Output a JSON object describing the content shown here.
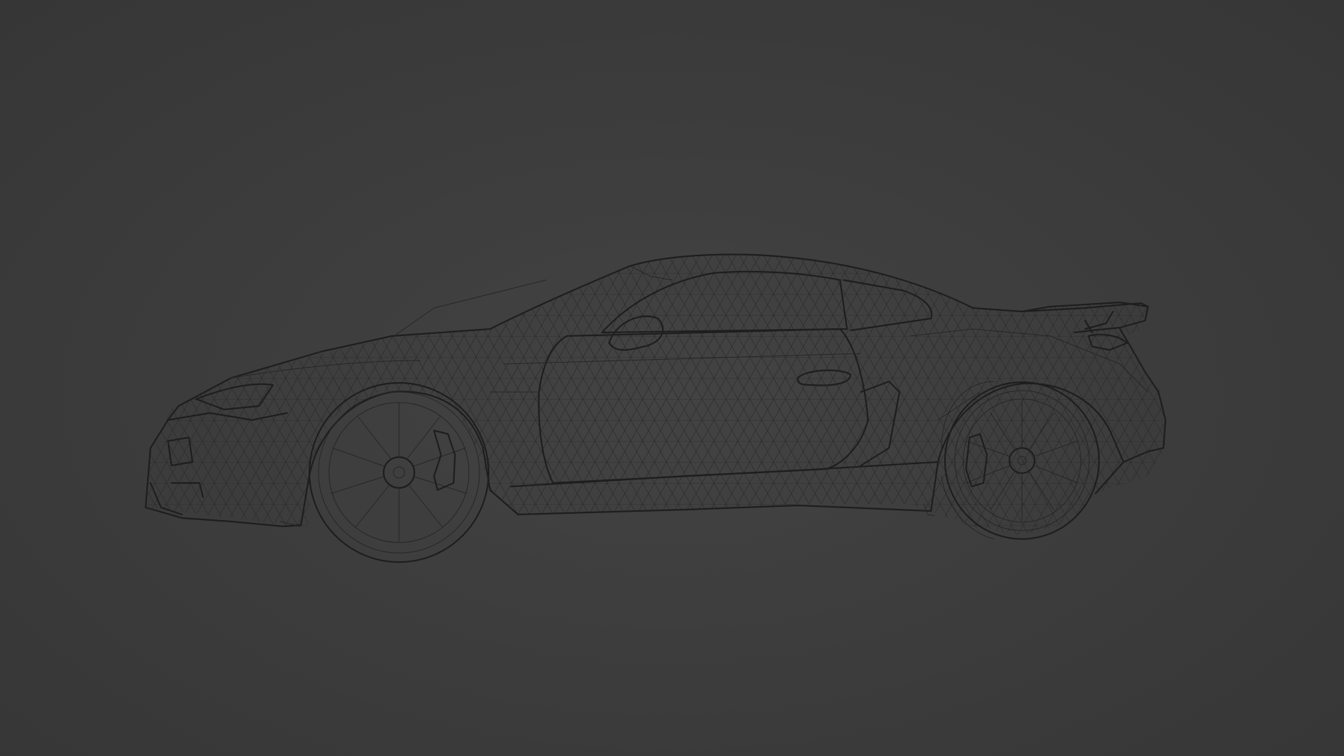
{
  "viewport": {
    "background_color": "#3c3c3c",
    "wire_color": "#1e1e1e",
    "display_mode": "wireframe"
  }
}
